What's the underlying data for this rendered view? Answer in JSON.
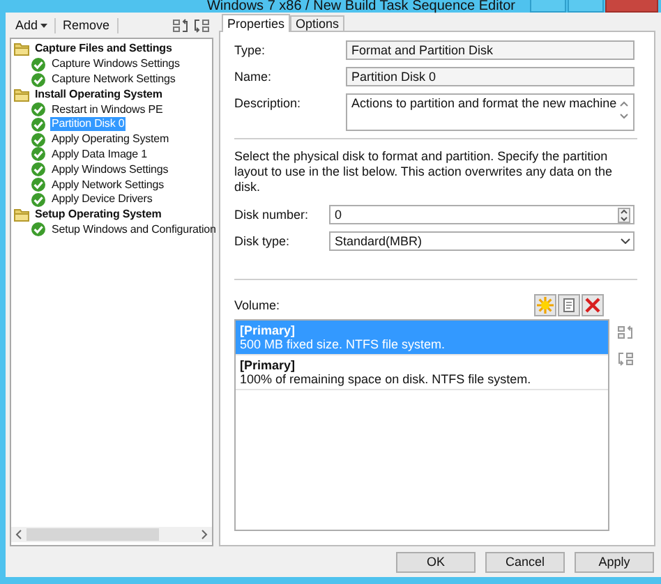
{
  "window": {
    "title": "Windows 7 x86 / New Build Task Sequence Editor"
  },
  "toolbar": {
    "buttons": [
      {
        "label": "Add",
        "kind": "dropdown"
      },
      {
        "label": "Remove",
        "kind": "plain"
      }
    ]
  },
  "tree": [
    {
      "label": "Capture Files and Settings",
      "kind": "group",
      "selected": false,
      "children": [
        {
          "label": "Capture Windows Settings",
          "kind": "step",
          "selected": false
        },
        {
          "label": "Capture Network Settings",
          "kind": "step",
          "selected": false
        }
      ]
    },
    {
      "label": "Install Operating System",
      "kind": "group",
      "selected": false,
      "children": [
        {
          "label": "Restart in Windows PE",
          "kind": "step",
          "selected": false
        },
        {
          "label": "Partition Disk 0",
          "kind": "step",
          "selected": true
        },
        {
          "label": "Apply Operating System",
          "kind": "step",
          "selected": false
        },
        {
          "label": "Apply Data Image 1",
          "kind": "step",
          "selected": false
        },
        {
          "label": "Apply Windows Settings",
          "kind": "step",
          "selected": false
        },
        {
          "label": "Apply Network Settings",
          "kind": "step",
          "selected": false
        },
        {
          "label": "Apply Device Drivers",
          "kind": "step",
          "selected": false
        }
      ]
    },
    {
      "label": "Setup Operating System",
      "kind": "group",
      "selected": false,
      "children": [
        {
          "label": "Setup Windows and Configuration",
          "kind": "step",
          "selected": false
        }
      ]
    }
  ],
  "tabs": [
    {
      "label": "Properties",
      "selected": true
    },
    {
      "label": "Options",
      "selected": false
    }
  ],
  "properties": {
    "type": {
      "label": "Type:",
      "value": "Format and Partition Disk"
    },
    "name": {
      "label": "Name:",
      "value": "Partition Disk 0"
    },
    "description": {
      "label": "Description:",
      "value": "Actions to partition and format the new machine"
    }
  },
  "instructions": "Select the physical disk to format and partition. Specify the partition layout to use in the list below. This action overwrites any data on the disk.",
  "disk_number": {
    "label": "Disk number:",
    "value": "0"
  },
  "disk_type": {
    "label": "Disk type:",
    "value": "Standard(MBR)"
  },
  "volume": {
    "label": "Volume:",
    "items": [
      {
        "title": "[Primary]",
        "detail": "500 MB fixed size. NTFS file system.",
        "selected": true
      },
      {
        "title": "[Primary]",
        "detail": "100% of remaining space on disk. NTFS file system.",
        "selected": false
      }
    ]
  },
  "buttons": [
    "OK",
    "Cancel",
    "Apply"
  ]
}
